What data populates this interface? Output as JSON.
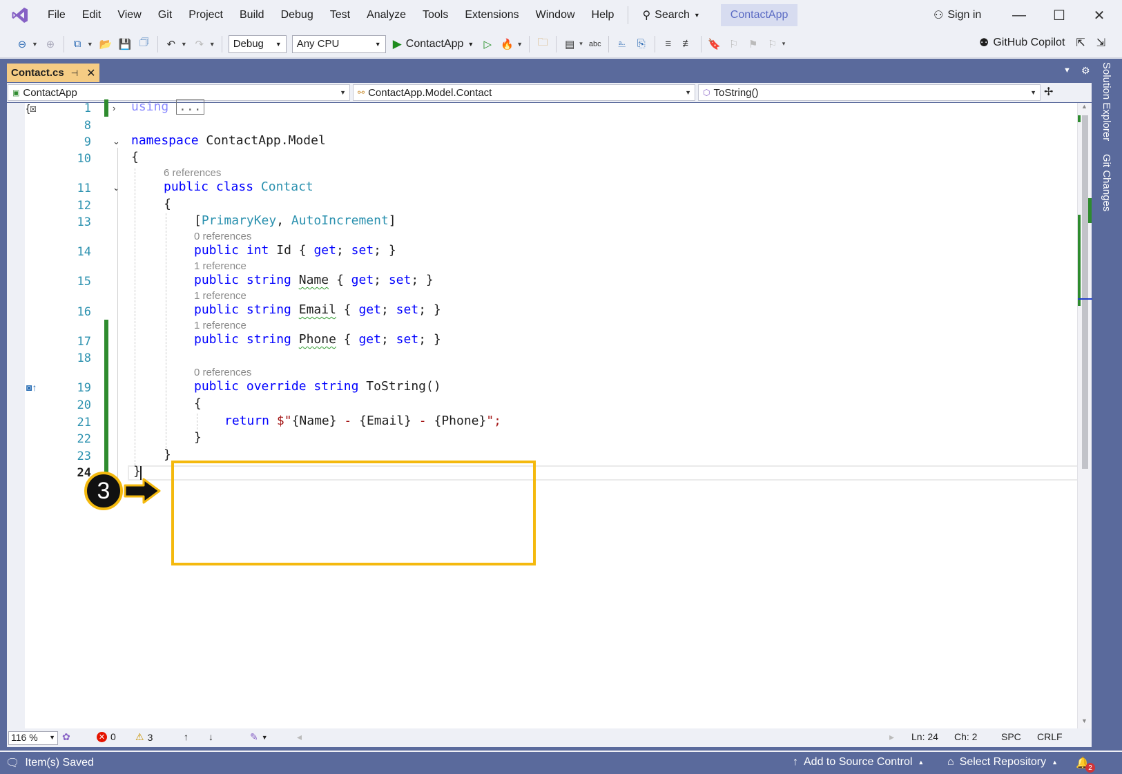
{
  "menubar": {
    "logo_icon": "visual-studio-logo-icon",
    "items": [
      "File",
      "Edit",
      "View",
      "Git",
      "Project",
      "Build",
      "Debug",
      "Test",
      "Analyze",
      "Tools",
      "Extensions",
      "Window",
      "Help"
    ],
    "search_label": "Search",
    "solution_title": "ContactApp",
    "sign_in_label": "Sign in"
  },
  "toolbar": {
    "configuration": "Debug",
    "platform": "Any CPU",
    "run_target": "ContactApp",
    "copilot_label": "GitHub Copilot"
  },
  "tab": {
    "file_name": "Contact.cs"
  },
  "side_panels": [
    "Solution Explorer",
    "Git Changes"
  ],
  "navbar": {
    "project": "ContactApp",
    "type": "ContactApp.Model.Contact",
    "member": "ToString()"
  },
  "editor": {
    "line_numbers": [
      "1",
      "8",
      "9",
      "10",
      "11",
      "12",
      "13",
      "14",
      "15",
      "16",
      "17",
      "18",
      "19",
      "20",
      "21",
      "22",
      "23",
      "24"
    ],
    "using_keyword": "using",
    "using_collapsed": "...",
    "namespace_kw": "namespace",
    "namespace_name": "ContactApp.Model",
    "open_brace": "{",
    "close_brace": "}",
    "class_lens": "6 references",
    "kw_public": "public",
    "kw_class": "class",
    "class_name": "Contact",
    "attr_open": "[",
    "attr_primary": "PrimaryKey",
    "attr_comma": ", ",
    "attr_auto": "AutoIncrement",
    "attr_close": "]",
    "lens_id": "0 references",
    "lens_name": "1 reference",
    "lens_email": "1 reference",
    "lens_phone": "1 reference",
    "lens_tostring": "0 references",
    "kw_int": "int",
    "kw_string": "string",
    "prop_id": "Id",
    "prop_name": "Name",
    "prop_email": "Email",
    "prop_phone": "Phone",
    "accessors_open": "{ ",
    "kw_get": "get",
    "semi": ";",
    "kw_set": "set",
    "accessors_close": " }",
    "kw_override": "override",
    "method_name": "ToString()",
    "kw_return": "return",
    "interp_start": "$\"",
    "interp_name": "{Name}",
    "interp_sep": " - ",
    "interp_email": "{Email}",
    "interp_phone": "{Phone}",
    "interp_end": "\";"
  },
  "annotation": {
    "step_number": "3"
  },
  "editor_status": {
    "zoom": "116 %",
    "errors": "0",
    "warnings": "3",
    "line": "Ln: 24",
    "char": "Ch: 2",
    "whitespace": "SPC",
    "line_ending": "CRLF"
  },
  "statusbar": {
    "message": "Item(s) Saved",
    "add_source_control": "Add to Source Control",
    "select_repository": "Select Repository",
    "notifications": "2"
  },
  "colors": {
    "accent_frame": "#5a6a9c",
    "tab_active": "#f5cc84",
    "highlight": "#f4b90e",
    "keyword": "#0000ff",
    "type": "#2b91af",
    "string": "#a31515",
    "change_bar": "#2e8b2e"
  }
}
